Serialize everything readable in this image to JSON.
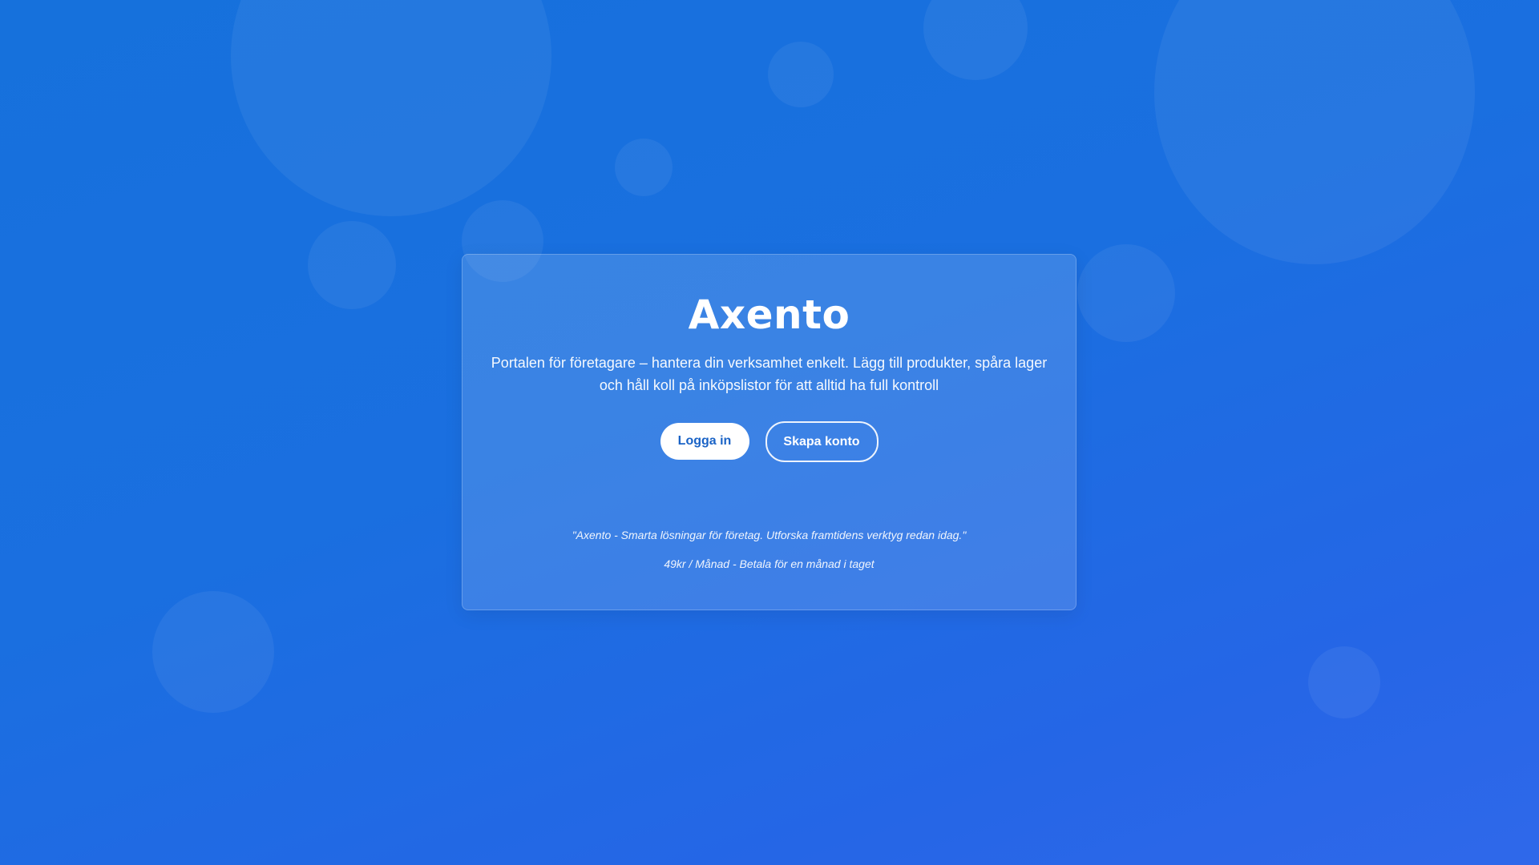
{
  "brand": {
    "name": "Axento",
    "tagline": "Portalen för företagare – hantera din verksamhet enkelt. Lägg till produkter, spåra lager och håll koll på inköpslistor för att alltid ha full kontroll"
  },
  "actions": {
    "login_label": "Logga in",
    "signup_label": "Skapa konto"
  },
  "footer": {
    "quote": "\"Axento - Smarta lösningar för företag. Utforska framtidens verktyg redan idag.\"",
    "price": "49kr / Månad - Betala för en månad i taget"
  },
  "colors": {
    "background": "#1a6fe0",
    "primary_button_text": "#1a63c6"
  }
}
